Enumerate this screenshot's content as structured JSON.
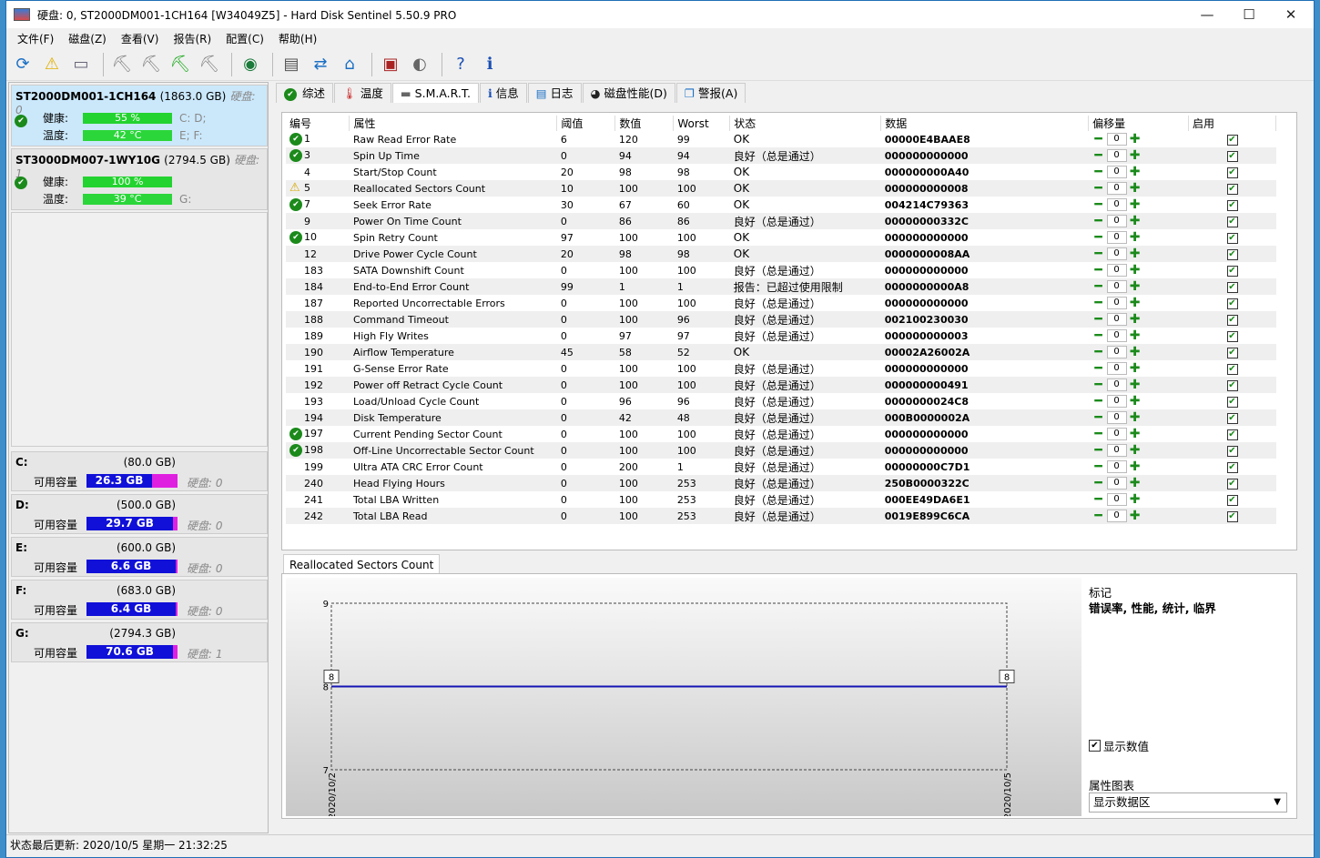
{
  "window": {
    "title": "硬盘:  0, ST2000DM001-1CH164 [W34049Z5]  -  Hard Disk Sentinel 5.50.9 PRO",
    "minimize": "—",
    "maximize": "☐",
    "close": "✕"
  },
  "menu": [
    "文件(F)",
    "磁盘(Z)",
    "查看(V)",
    "报告(R)",
    "配置(C)",
    "帮助(H)"
  ],
  "toolbar": [
    "refresh-icon",
    "warning-icon",
    "disk-icon",
    "disk-tool-icon-1",
    "disk-tool-icon-2",
    "disk-tool-icon-3",
    "disk-tool-icon-4",
    "globe-icon",
    "report-icon",
    "send-icon",
    "network-icon",
    "monitor-icon",
    "speaker-icon",
    "help-icon",
    "info-icon"
  ],
  "disks": [
    {
      "name": "ST2000DM001-1CH164",
      "size": "(1863.0 GB)",
      "disk_label": "硬盘:  0",
      "health_label": "健康:",
      "health": "55 %",
      "health_pct": 55,
      "temp_label": "温度:",
      "temp": "42 °C",
      "health_drives": "C: D;",
      "temp_drives": "E; F:"
    },
    {
      "name": "ST3000DM007-1WY10G",
      "size": "(2794.5 GB)",
      "disk_label": "硬盘:  1",
      "health_label": "健康:",
      "health": "100 %",
      "health_pct": 100,
      "temp_label": "温度:",
      "temp": "39 °C",
      "health_drives": "",
      "temp_drives": "G:"
    }
  ],
  "volumes": [
    {
      "letter": "C:",
      "size": "(80.0 GB)",
      "free_label": "可用容量",
      "free": "26.3 GB",
      "disk": "硬盘:  0"
    },
    {
      "letter": "D:",
      "size": "(500.0 GB)",
      "free_label": "可用容量",
      "free": "29.7 GB",
      "disk": "硬盘:  0"
    },
    {
      "letter": "E:",
      "size": "(600.0 GB)",
      "free_label": "可用容量",
      "free": "6.6 GB",
      "disk": "硬盘:  0"
    },
    {
      "letter": "F:",
      "size": "(683.0 GB)",
      "free_label": "可用容量",
      "free": "6.4 GB",
      "disk": "硬盘:  0"
    },
    {
      "letter": "G:",
      "size": "(2794.3 GB)",
      "free_label": "可用容量",
      "free": "70.6 GB",
      "disk": "硬盘:  1"
    }
  ],
  "tabs": [
    "综述",
    "温度",
    "S.M.A.R.T.",
    "信息",
    "日志",
    "磁盘性能(D)",
    "警报(A)"
  ],
  "smart": {
    "headers": [
      "编号",
      "属性",
      "阈值",
      "数值",
      "Worst",
      "状态",
      "数据",
      "偏移量",
      "启用"
    ],
    "rows": [
      {
        "icon": "ok",
        "id": "1",
        "attr": "Raw Read Error Rate",
        "thr": "6",
        "val": "120",
        "worst": "99",
        "status": "OK",
        "data": "00000E4BAAE8"
      },
      {
        "icon": "ok",
        "id": "3",
        "attr": "Spin Up Time",
        "thr": "0",
        "val": "94",
        "worst": "94",
        "status": "良好（总是通过）",
        "data": "000000000000"
      },
      {
        "icon": "",
        "id": "4",
        "attr": "Start/Stop Count",
        "thr": "20",
        "val": "98",
        "worst": "98",
        "status": "OK",
        "data": "000000000A40"
      },
      {
        "icon": "warn",
        "id": "5",
        "attr": "Reallocated Sectors Count",
        "thr": "10",
        "val": "100",
        "worst": "100",
        "status": "OK",
        "data": "000000000008"
      },
      {
        "icon": "ok",
        "id": "7",
        "attr": "Seek Error Rate",
        "thr": "30",
        "val": "67",
        "worst": "60",
        "status": "OK",
        "data": "004214C79363"
      },
      {
        "icon": "",
        "id": "9",
        "attr": "Power On Time Count",
        "thr": "0",
        "val": "86",
        "worst": "86",
        "status": "良好（总是通过）",
        "data": "00000000332C"
      },
      {
        "icon": "ok",
        "id": "10",
        "attr": "Spin Retry Count",
        "thr": "97",
        "val": "100",
        "worst": "100",
        "status": "OK",
        "data": "000000000000"
      },
      {
        "icon": "",
        "id": "12",
        "attr": "Drive Power Cycle Count",
        "thr": "20",
        "val": "98",
        "worst": "98",
        "status": "OK",
        "data": "0000000008AA"
      },
      {
        "icon": "",
        "id": "183",
        "attr": "SATA Downshift Count",
        "thr": "0",
        "val": "100",
        "worst": "100",
        "status": "良好（总是通过）",
        "data": "000000000000"
      },
      {
        "icon": "",
        "id": "184",
        "attr": "End-to-End Error Count",
        "thr": "99",
        "val": "1",
        "worst": "1",
        "status": "报告：已超过使用限制",
        "data": "0000000000A8"
      },
      {
        "icon": "",
        "id": "187",
        "attr": "Reported Uncorrectable Errors",
        "thr": "0",
        "val": "100",
        "worst": "100",
        "status": "良好（总是通过）",
        "data": "000000000000"
      },
      {
        "icon": "",
        "id": "188",
        "attr": "Command Timeout",
        "thr": "0",
        "val": "100",
        "worst": "96",
        "status": "良好（总是通过）",
        "data": "002100230030"
      },
      {
        "icon": "",
        "id": "189",
        "attr": "High Fly Writes",
        "thr": "0",
        "val": "97",
        "worst": "97",
        "status": "良好（总是通过）",
        "data": "000000000003"
      },
      {
        "icon": "",
        "id": "190",
        "attr": "Airflow Temperature",
        "thr": "45",
        "val": "58",
        "worst": "52",
        "status": "OK",
        "data": "00002A26002A"
      },
      {
        "icon": "",
        "id": "191",
        "attr": "G-Sense Error Rate",
        "thr": "0",
        "val": "100",
        "worst": "100",
        "status": "良好（总是通过）",
        "data": "000000000000"
      },
      {
        "icon": "",
        "id": "192",
        "attr": "Power off Retract Cycle Count",
        "thr": "0",
        "val": "100",
        "worst": "100",
        "status": "良好（总是通过）",
        "data": "000000000491"
      },
      {
        "icon": "",
        "id": "193",
        "attr": "Load/Unload Cycle Count",
        "thr": "0",
        "val": "96",
        "worst": "96",
        "status": "良好（总是通过）",
        "data": "0000000024C8"
      },
      {
        "icon": "",
        "id": "194",
        "attr": "Disk Temperature",
        "thr": "0",
        "val": "42",
        "worst": "48",
        "status": "良好（总是通过）",
        "data": "000B0000002A"
      },
      {
        "icon": "ok",
        "id": "197",
        "attr": "Current Pending Sector Count",
        "thr": "0",
        "val": "100",
        "worst": "100",
        "status": "良好（总是通过）",
        "data": "000000000000"
      },
      {
        "icon": "ok",
        "id": "198",
        "attr": "Off-Line Uncorrectable Sector Count",
        "thr": "0",
        "val": "100",
        "worst": "100",
        "status": "良好（总是通过）",
        "data": "000000000000"
      },
      {
        "icon": "",
        "id": "199",
        "attr": "Ultra ATA CRC Error Count",
        "thr": "0",
        "val": "200",
        "worst": "1",
        "status": "良好（总是通过）",
        "data": "00000000C7D1"
      },
      {
        "icon": "",
        "id": "240",
        "attr": "Head Flying Hours",
        "thr": "0",
        "val": "100",
        "worst": "253",
        "status": "良好（总是通过）",
        "data": "250B0000322C"
      },
      {
        "icon": "",
        "id": "241",
        "attr": "Total LBA Written",
        "thr": "0",
        "val": "100",
        "worst": "253",
        "status": "良好（总是通过）",
        "data": "000EE49DA6E1"
      },
      {
        "icon": "",
        "id": "242",
        "attr": "Total LBA Read",
        "thr": "0",
        "val": "100",
        "worst": "253",
        "status": "良好（总是通过）",
        "data": "0019E899C6CA"
      }
    ],
    "offset_value": "0"
  },
  "chart_tab": "Reallocated Sectors Count",
  "chart_data": {
    "type": "line",
    "x": [
      "2020/10/2",
      "2020/10/5"
    ],
    "series": [
      {
        "values": [
          8,
          8
        ]
      }
    ],
    "ylim": [
      7,
      9
    ],
    "yticks": [
      "9",
      "8",
      "7"
    ],
    "point_labels": [
      "8",
      "8"
    ],
    "color": "#1414b4"
  },
  "chart_side": {
    "marker_label": "标记",
    "marker_value": "错误率, 性能, 统计, 临界",
    "show_values_label": "显示数值",
    "attr_chart_label": "属性图表",
    "attr_chart_select": "显示数据区"
  },
  "status": "状态最后更新:   2020/10/5 星期一 21:32:25"
}
